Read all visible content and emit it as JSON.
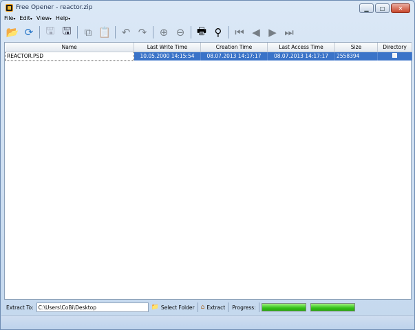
{
  "window": {
    "title": "Free Opener - reactor.zip"
  },
  "menu": [
    {
      "label": "File"
    },
    {
      "label": "Edit"
    },
    {
      "label": "View"
    },
    {
      "label": "Help"
    }
  ],
  "toolbar": [
    {
      "icon": "open-folder-icon",
      "enabled": true
    },
    {
      "icon": "refresh-icon",
      "enabled": true
    },
    {
      "icon": "save-icon",
      "enabled": false
    },
    {
      "icon": "save-as-icon",
      "enabled": true
    },
    {
      "icon": "copy-icon",
      "enabled": false
    },
    {
      "icon": "paste-icon",
      "enabled": false
    },
    {
      "icon": "undo-icon",
      "enabled": false
    },
    {
      "icon": "redo-icon",
      "enabled": false
    },
    {
      "icon": "zoom-in-icon",
      "enabled": false
    },
    {
      "icon": "zoom-out-icon",
      "enabled": false
    },
    {
      "icon": "print-icon",
      "enabled": true
    },
    {
      "icon": "find-binoculars-icon",
      "enabled": true
    },
    {
      "icon": "first-page-icon",
      "enabled": false
    },
    {
      "icon": "previous-page-icon",
      "enabled": false
    },
    {
      "icon": "next-page-icon",
      "enabled": false
    },
    {
      "icon": "last-page-icon",
      "enabled": false
    }
  ],
  "table": {
    "columns": [
      "Name",
      "Last Write Time",
      "Creation Time",
      "Last Access Time",
      "Size",
      "Directory"
    ],
    "rows": [
      {
        "name": "REACTOR.PSD",
        "last_write": "10.05.2000 14:15:54",
        "created": "08.07.2013 14:17:17",
        "last_access": "08.07.2013 14:17:17",
        "size": "2558394",
        "directory": false
      }
    ]
  },
  "bottom": {
    "extract_to_label": "Extract To:",
    "path_value": "C:\\Users\\CoBi\\Desktop",
    "select_folder_label": "Select Folder",
    "extract_label": "Extract",
    "progress_label": "Progress:",
    "progress_1": 1.0,
    "progress_2": 1.0
  },
  "colors": {
    "selection": "#3a73c8",
    "progress": "#33c018",
    "window_frame": "#c4d8ee"
  }
}
